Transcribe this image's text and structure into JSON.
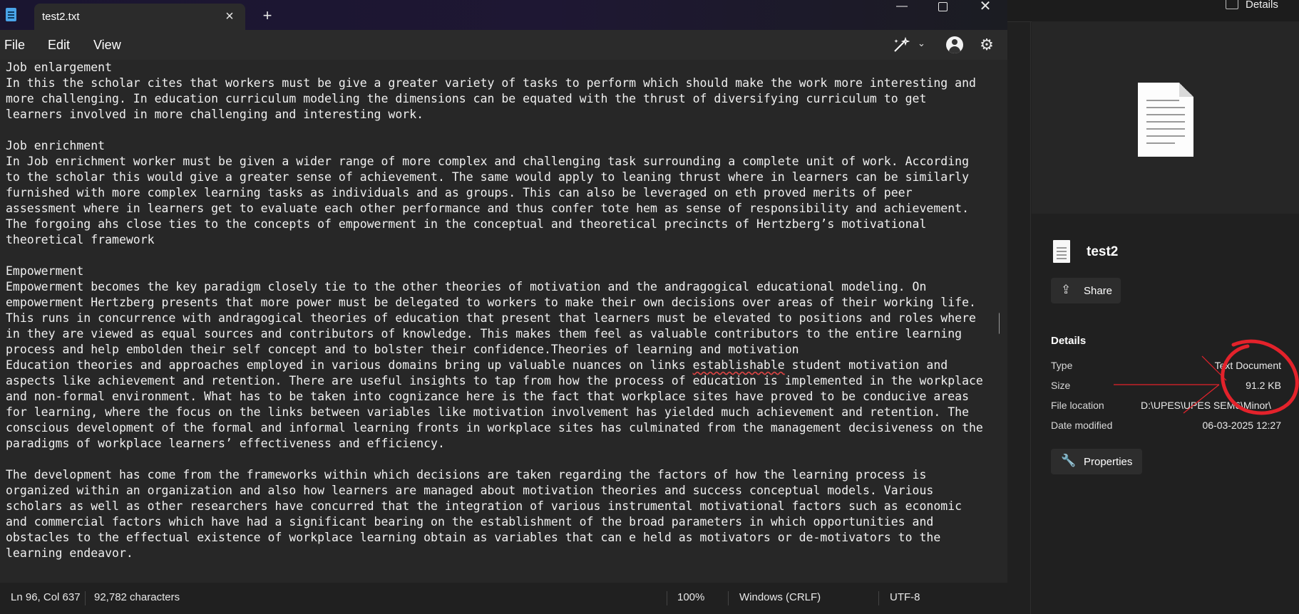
{
  "window": {
    "tab_title": "test2.txt",
    "tab_close": "×",
    "new_tab": "+",
    "minimize": "—",
    "close": "✕"
  },
  "menu": {
    "file": "File",
    "edit": "Edit",
    "view": "View"
  },
  "editor": {
    "lines": [
      "Job enlargement",
      "In this the scholar cites that workers must be give a greater variety of tasks to perform which should make the work more interesting and",
      "more challenging. In education curriculum modeling the dimensions can be equated with the thrust of diversifying curriculum to get",
      "learners involved in more challenging and interesting work.",
      "",
      "Job enrichment",
      "In Job enrichment worker must be given a wider range of more complex and challenging task surrounding a complete unit of work. According",
      "to the scholar this would give a greater sense of achievement. The same would apply to leaning thrust where in learners can be similarly",
      "furnished with more complex learning tasks as individuals and as groups. This can also be leveraged on eth proved merits of peer",
      "assessment where in learners get to evaluate each other performance and thus confer tote hem as sense of responsibility and achievement.",
      "The forgoing ahs close ties to the concepts of empowerment in the conceptual and theoretical precincts of Hertzberg’s motivational",
      "theoretical framework",
      "",
      "Empowerment",
      "Empowerment becomes the key paradigm closely tie to the other theories of motivation and the andragogical educational modeling. On",
      "empowerment Hertzberg presents that more power must be delegated to workers to make their own decisions over areas of their working life.",
      "This runs in concurrence with andragogical theories of education that present that learners must be elevated to positions and roles where",
      "in they are viewed as equal sources and contributors of knowledge. This makes them feel as valuable contributors to the entire learning",
      "process and help embolden their self concept and to bolster their confidence.Theories of learning and motivation",
      "Education theories and approaches employed in various domains bring up valuable nuances on links establishable student motivation and",
      "aspects like achievement and retention. There are useful insights to tap from how the process of education is implemented in the workplace",
      "and non-formal environment. What has to be taken into cognizance here is the fact that workplace sites have proved to be conducive areas",
      "for learning, where the focus on the links between variables like motivation involvement has yielded much achievement and retention. The",
      "conscious development of the formal and informal learning fronts in workplace sites has culminated from the management decisiveness on the",
      "paradigms of workplace learners’ effectiveness and efficiency.",
      "",
      "The development has come from the frameworks within which decisions are taken regarding the factors of how the learning process is",
      "organized within an organization and also how learners are managed about motivation theories and success conceptual models. Various",
      "scholars as well as other researchers have concurred that the integration of various instrumental motivational factors such as economic",
      "and commercial factors which have had a significant bearing on the establishment of the broad parameters in which opportunities and",
      "obstacles to the effectual existence of workplace learning obtain as variables that can e held as motivators or de-motivators to the",
      "learning endeavor."
    ]
  },
  "status": {
    "position": "Ln 96, Col 637",
    "characters": "92,782 characters",
    "zoom": "100%",
    "line_ending": "Windows (CRLF)",
    "encoding": "UTF-8"
  },
  "details_pane": {
    "toggle_label": "Details",
    "file_name": "test2",
    "share_label": "Share",
    "details_heading": "Details",
    "rows": {
      "type_key": "Type",
      "type_value": "Text Document",
      "size_key": "Size",
      "size_value": "91.2 KB",
      "location_key": "File location",
      "location_value": "D:\\UPES\\UPES SEM6\\Minor\\",
      "modified_key": "Date modified",
      "modified_value": "06-03-2025 12:27"
    },
    "properties_label": "Properties"
  },
  "colors": {
    "editor_bg": "#272727",
    "annotation_red": "#e3222b"
  }
}
